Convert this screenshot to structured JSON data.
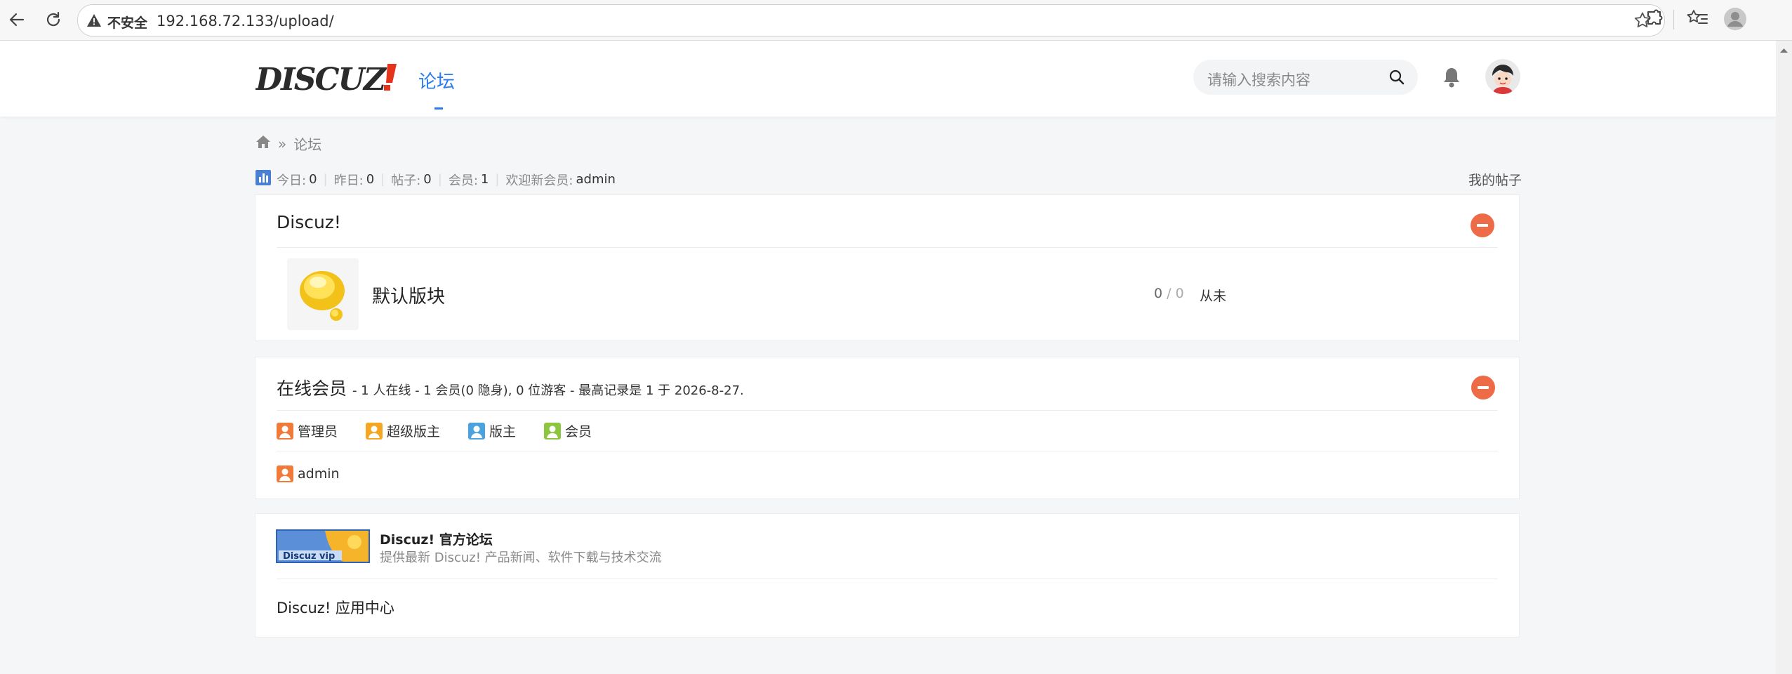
{
  "browser": {
    "insecure_label": "不安全",
    "url": "192.168.72.133/upload/"
  },
  "header": {
    "logo_text": "DISCUZ!",
    "nav_forum": "论坛",
    "search_placeholder": "请输入搜索内容"
  },
  "breadcrumb": {
    "separator": "»",
    "current": "论坛"
  },
  "stats": {
    "today_label": "今日:",
    "today_value": "0",
    "yesterday_label": "昨日:",
    "yesterday_value": "0",
    "posts_label": "帖子:",
    "posts_value": "0",
    "members_label": "会员:",
    "members_value": "1",
    "welcome_label": "欢迎新会员:",
    "welcome_user": "admin",
    "my_posts": "我的帖子"
  },
  "category": {
    "title": "Discuz!",
    "forum": {
      "name": "默认版块",
      "threads": "0",
      "slash": "/",
      "posts": "0",
      "last_post": "从未"
    }
  },
  "online": {
    "title": "在线会员",
    "summary": "- 1 人在线 - 1 会员(0 隐身), 0 位游客 - 最高记录是 1 于 2026-8-27.",
    "legend": [
      {
        "label": "管理员",
        "color": "#f07a3a"
      },
      {
        "label": "超级版主",
        "color": "#f5a623"
      },
      {
        "label": "版主",
        "color": "#4aa3df"
      },
      {
        "label": "会员",
        "color": "#8cc63e"
      }
    ],
    "users": [
      {
        "name": "admin",
        "color": "#f07a3a"
      }
    ]
  },
  "links": {
    "image_text": "Discuz vip",
    "official_title": "Discuz! 官方论坛",
    "official_desc": "提供最新 Discuz! 产品新闻、软件下载与技术交流",
    "app_center": "Discuz! 应用中心"
  },
  "colors": {
    "accent": "#2b7dee",
    "collapse": "#ee6b48"
  }
}
